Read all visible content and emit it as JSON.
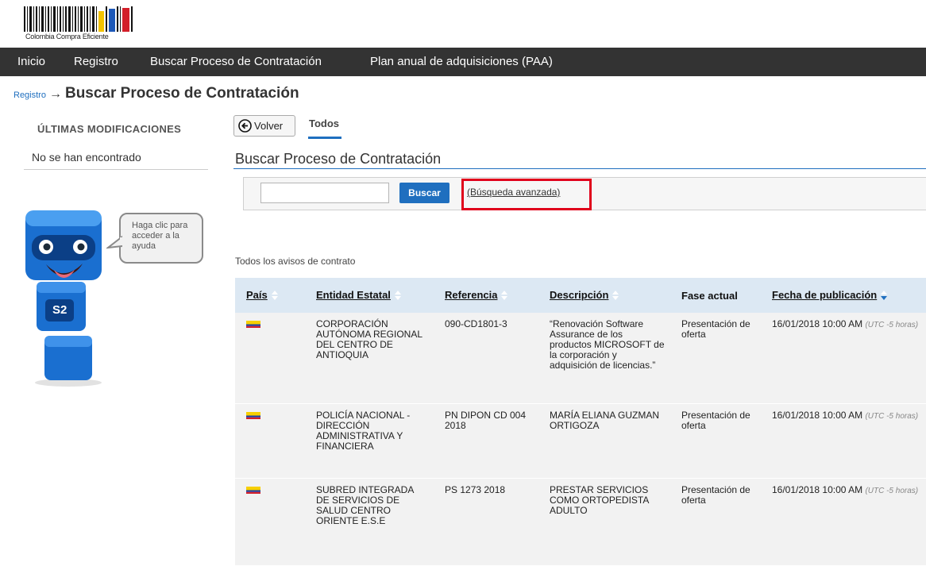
{
  "header": {
    "logo_text": "Colombia Compra Eficiente"
  },
  "nav": {
    "items": [
      {
        "label": "Inicio"
      },
      {
        "label": "Registro"
      },
      {
        "label": "Buscar Proceso de Contratación"
      },
      {
        "label": "Plan anual de adquisiciones (PAA)"
      }
    ]
  },
  "breadcrumb": {
    "parent": "Registro",
    "arrow": "→",
    "current": "Buscar Proceso de Contratación"
  },
  "sidebar": {
    "title": "ÚLTIMAS MODIFICACIONES",
    "empty_text": "No se han encontrado",
    "help_text": "Haga clic para acceder a la ayuda",
    "mascot_label": "S2"
  },
  "tabs": {
    "back_label": "Volver",
    "active_tab": "Todos"
  },
  "search": {
    "title": "Buscar Proceso de Contratación",
    "input_value": "",
    "button_label": "Buscar",
    "advanced_link": "(Búsqueda avanzada)"
  },
  "table": {
    "caption": "Todos los avisos de contrato",
    "headers": {
      "country": "País",
      "entity": "Entidad Estatal",
      "reference": "Referencia",
      "description": "Descripción",
      "phase": "Fase actual",
      "date": "Fecha de publicación"
    },
    "rows": [
      {
        "entity": "CORPORACIÓN AUTÓNOMA REGIONAL DEL CENTRO DE ANTIOQUIA",
        "reference": "090-CD1801-3",
        "description": "“Renovación Software Assurance de los productos MICROSOFT de la corporación y adquisición de licencias.”",
        "phase": "Presentación de oferta",
        "date": "16/01/2018 10:00 AM",
        "tz": "(UTC -5 horas)"
      },
      {
        "entity": "POLICÍA NACIONAL - DIRECCIÓN ADMINISTRATIVA Y FINANCIERA",
        "reference": "PN DIPON CD 004 2018",
        "description": "MARÍA ELIANA GUZMAN ORTIGOZA",
        "phase": "Presentación de oferta",
        "date": "16/01/2018 10:00 AM",
        "tz": "(UTC -5 horas)"
      },
      {
        "entity": "SUBRED INTEGRADA DE SERVICIOS DE SALUD CENTRO ORIENTE E.S.E",
        "reference": "PS 1273 2018",
        "description": "PRESTAR SERVICIOS COMO ORTOPEDISTA ADULTO",
        "phase": "Presentación de oferta",
        "date": "16/01/2018 10:00 AM",
        "tz": "(UTC -5 horas)"
      }
    ]
  },
  "colors": {
    "nav_bg": "#333333",
    "accent_blue": "#1f6fbf",
    "header_row_bg": "#dce8f3",
    "highlight_red": "#e0001b"
  }
}
